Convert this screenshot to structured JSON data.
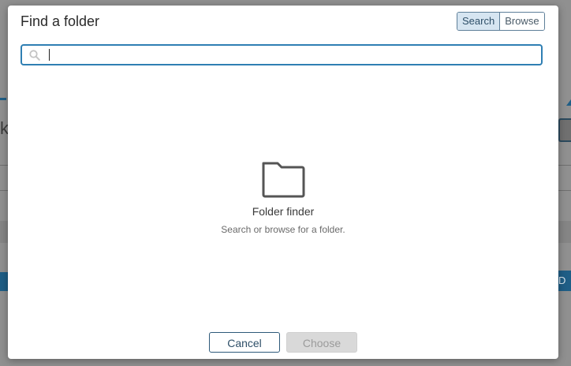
{
  "dialog": {
    "title": "Find a folder",
    "mode_toggle": {
      "search_label": "Search",
      "browse_label": "Browse",
      "active": "Search"
    },
    "search": {
      "value": "",
      "placeholder": ""
    },
    "empty_state": {
      "icon": "folder-icon",
      "title": "Folder finder",
      "subtitle": "Search or browse for a folder."
    },
    "footer": {
      "cancel_label": "Cancel",
      "choose_label": "Choose"
    }
  },
  "colors": {
    "accent": "#2f7fb3",
    "toggle_active_bg": "#d6e5f1",
    "disabled_bg": "#d9d9d9",
    "overlay": "#909090"
  }
}
